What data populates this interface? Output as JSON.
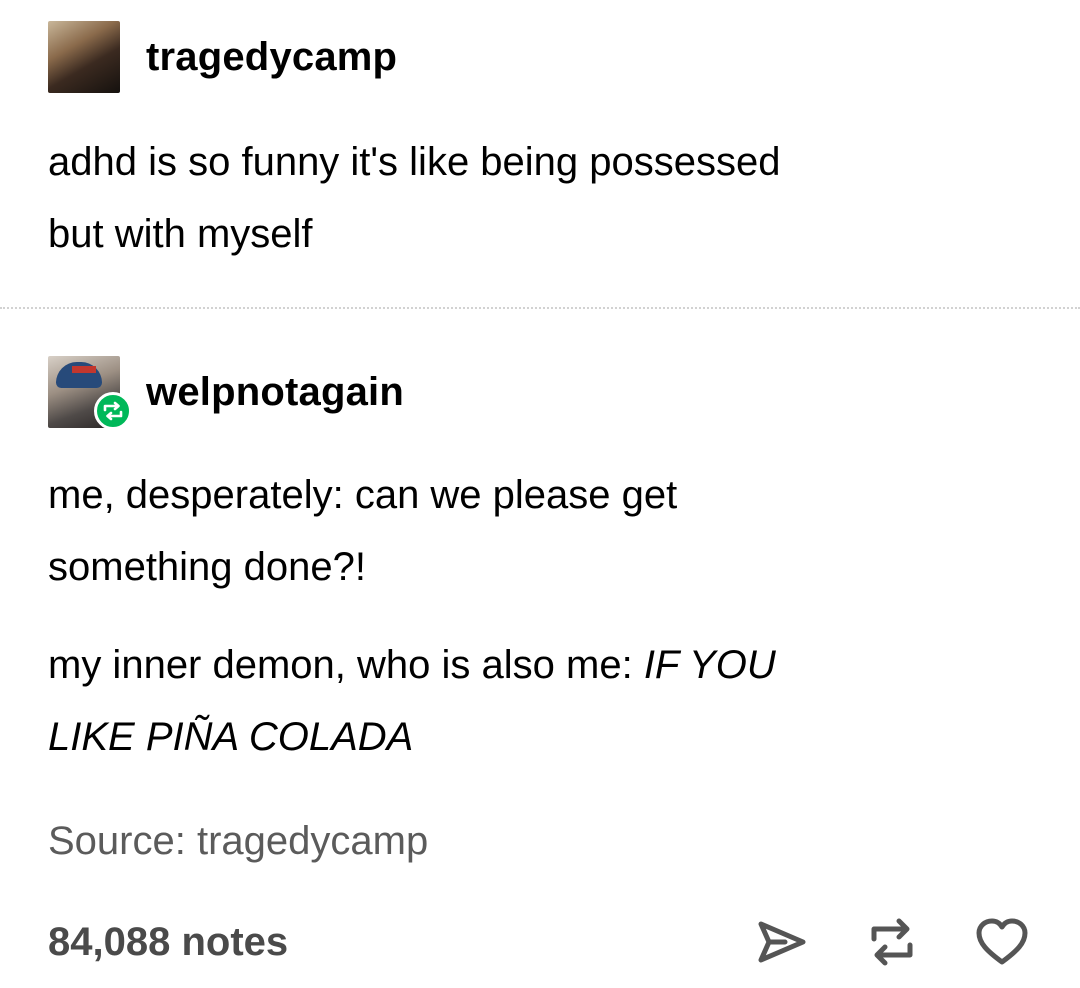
{
  "post": {
    "author": "tragedycamp",
    "text_lines": [
      "adhd is so funny it's like being possessed",
      "but with myself"
    ]
  },
  "reblog": {
    "author": "welpnotagain",
    "paragraph_one_lines": [
      "me, desperately: can we please get",
      "something done?!"
    ],
    "paragraph_two_line_one_plain": "my inner demon, who is also me: ",
    "paragraph_two_line_one_italic": "IF YOU",
    "paragraph_two_line_two_italic": "LIKE PIÑA COLADA"
  },
  "footer": {
    "source": "Source: tragedycamp",
    "notes": "84,088 notes"
  },
  "icons": {
    "share": "share-icon",
    "reblog": "reblog-icon",
    "like": "heart-icon",
    "reblog_badge": "reblog-badge-icon"
  },
  "colors": {
    "reblog_badge": "#00b859",
    "footer_text": "#5b5b5b"
  }
}
